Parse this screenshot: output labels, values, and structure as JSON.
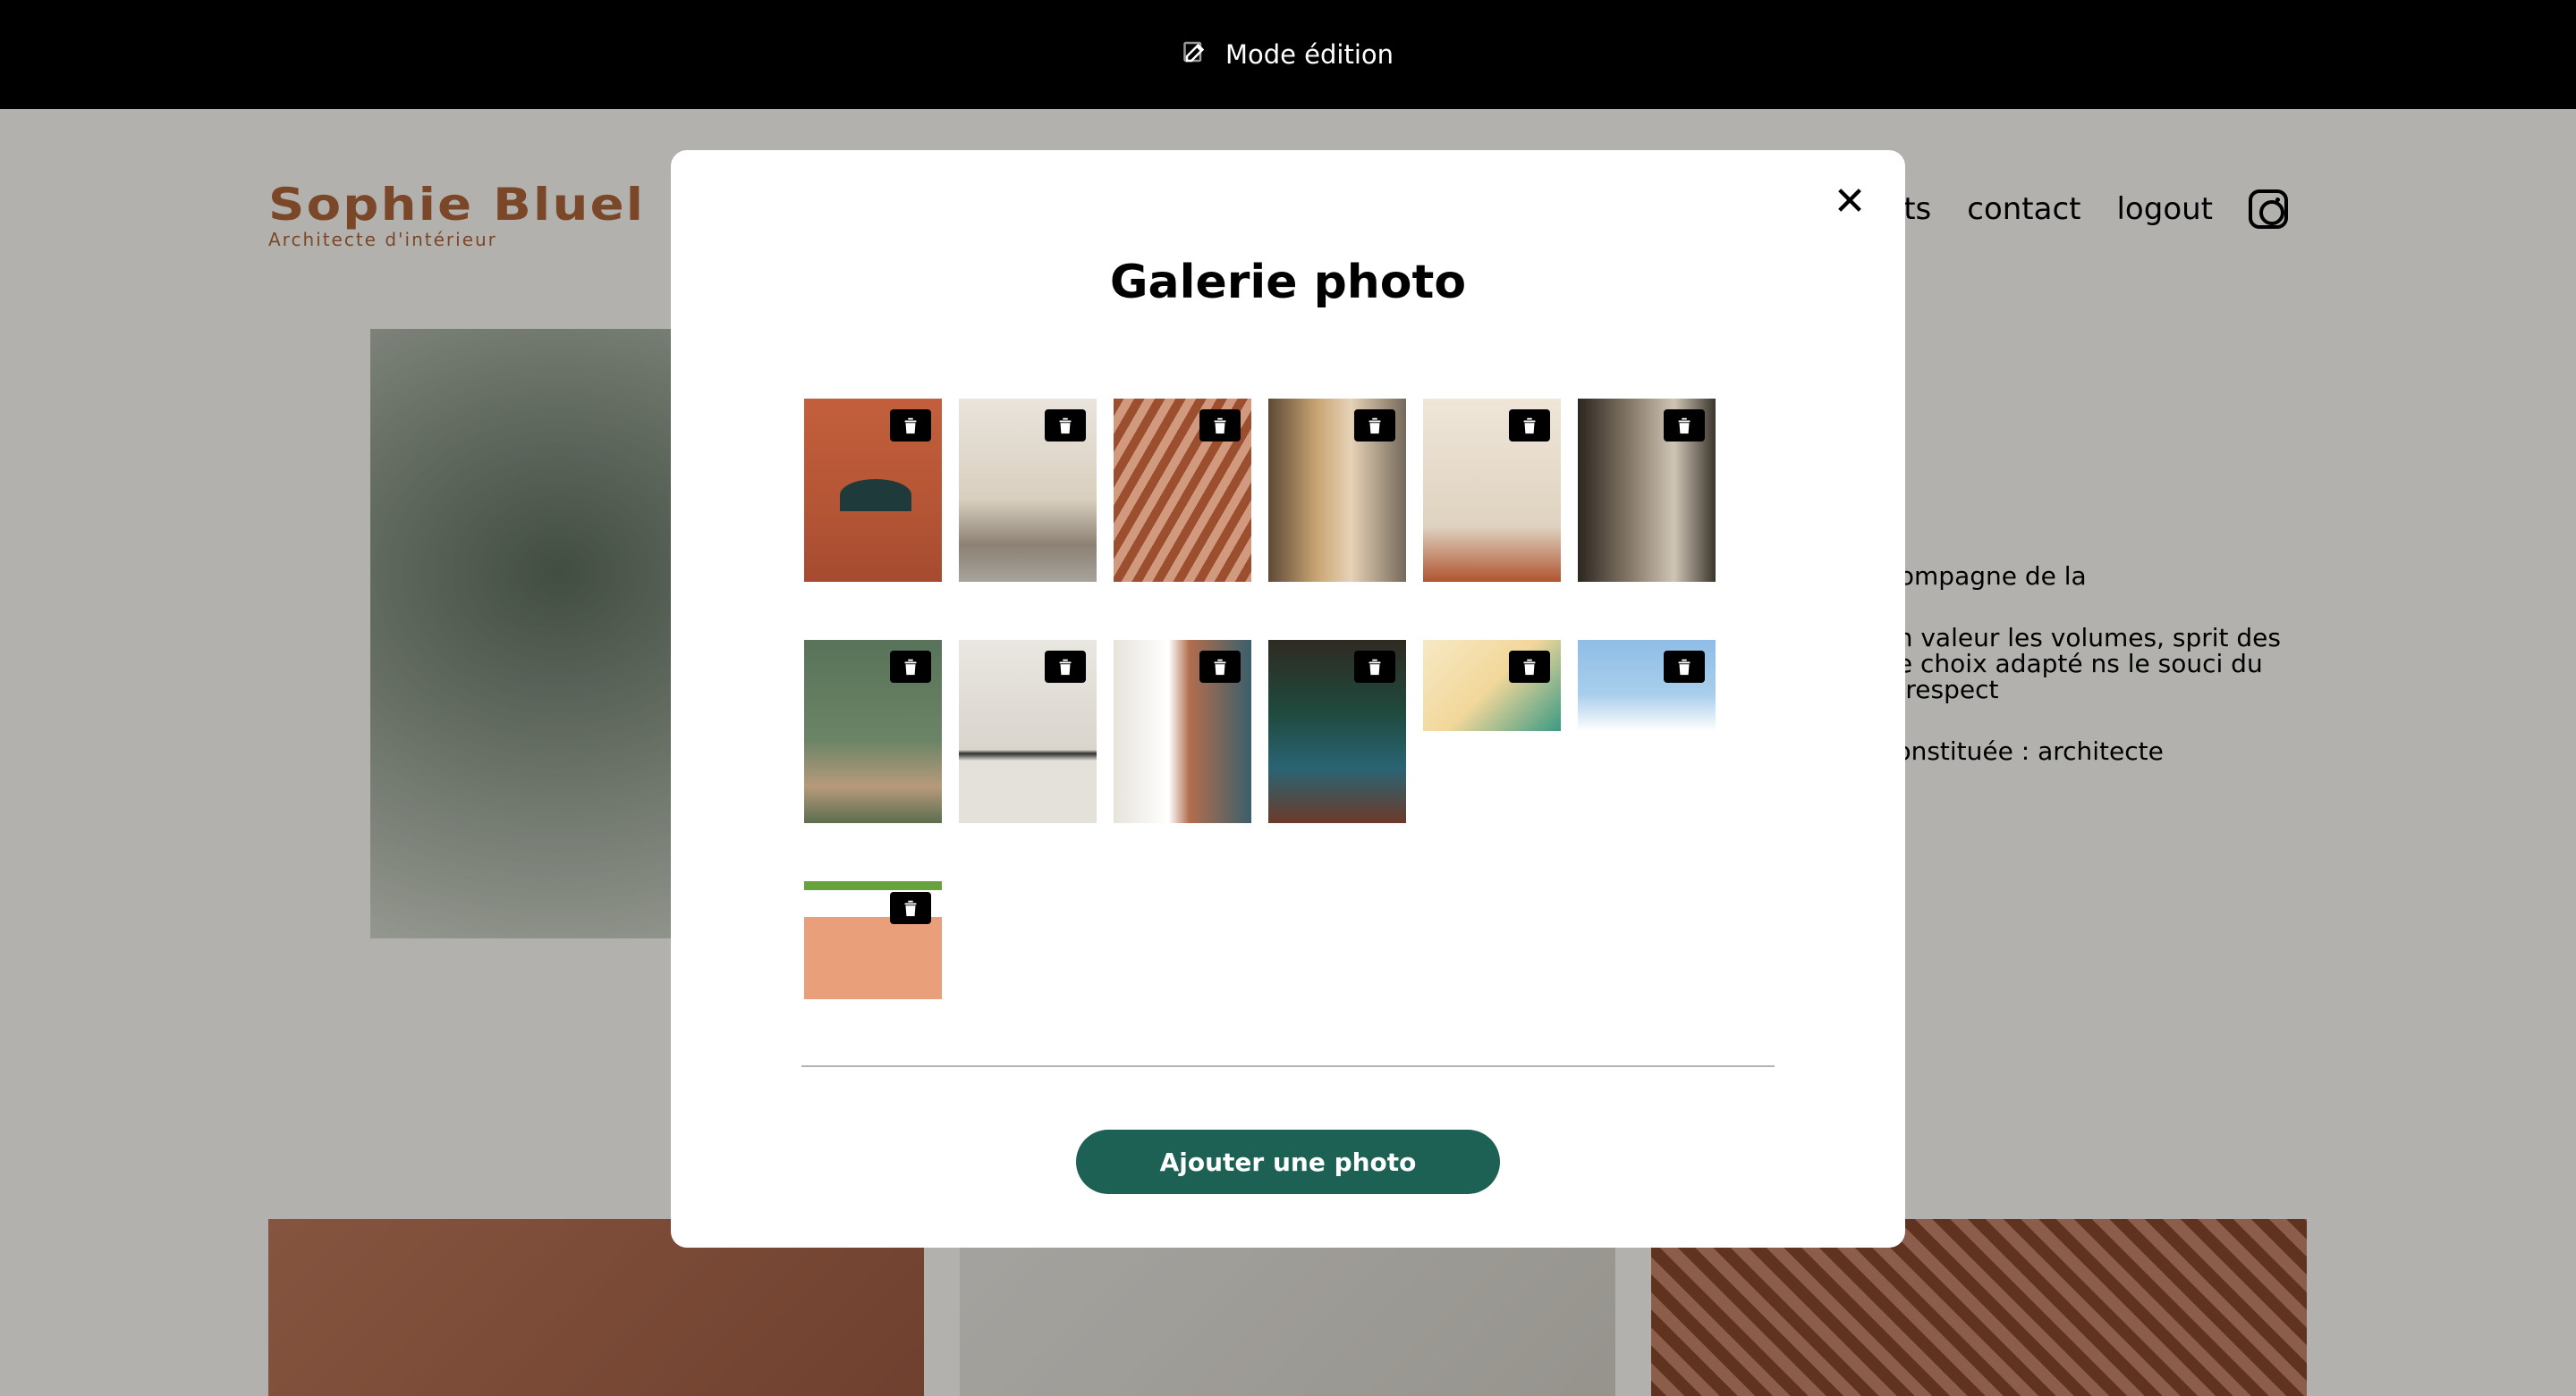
{
  "edit_bar": {
    "label": "Mode édition",
    "icon": "edit-icon"
  },
  "header": {
    "logo_title": "Sophie Bluel",
    "logo_subtitle": "Architecte d'intérieur",
    "nav": {
      "projects": "ets",
      "contact": "contact",
      "logout": "logout",
      "instagram_icon": "instagram-icon"
    }
  },
  "about": {
    "paragraphs": [
      "vous accompagne de la",
      "mettre en valeur les volumes, sprit des lieux et le choix adapté ns le souci du détail, le respect",
      "ut-être constituée : architecte"
    ]
  },
  "modal": {
    "title": "Galerie photo",
    "close_icon": "close-icon",
    "trash_icon": "trash-icon",
    "thumb_count": 13,
    "add_button": "Ajouter une photo"
  },
  "colors": {
    "brand": "#B1663C",
    "primary_button": "#1D6154",
    "edit_bar": "#000000",
    "overlay": "rgba(0,0,0,0.3)"
  }
}
